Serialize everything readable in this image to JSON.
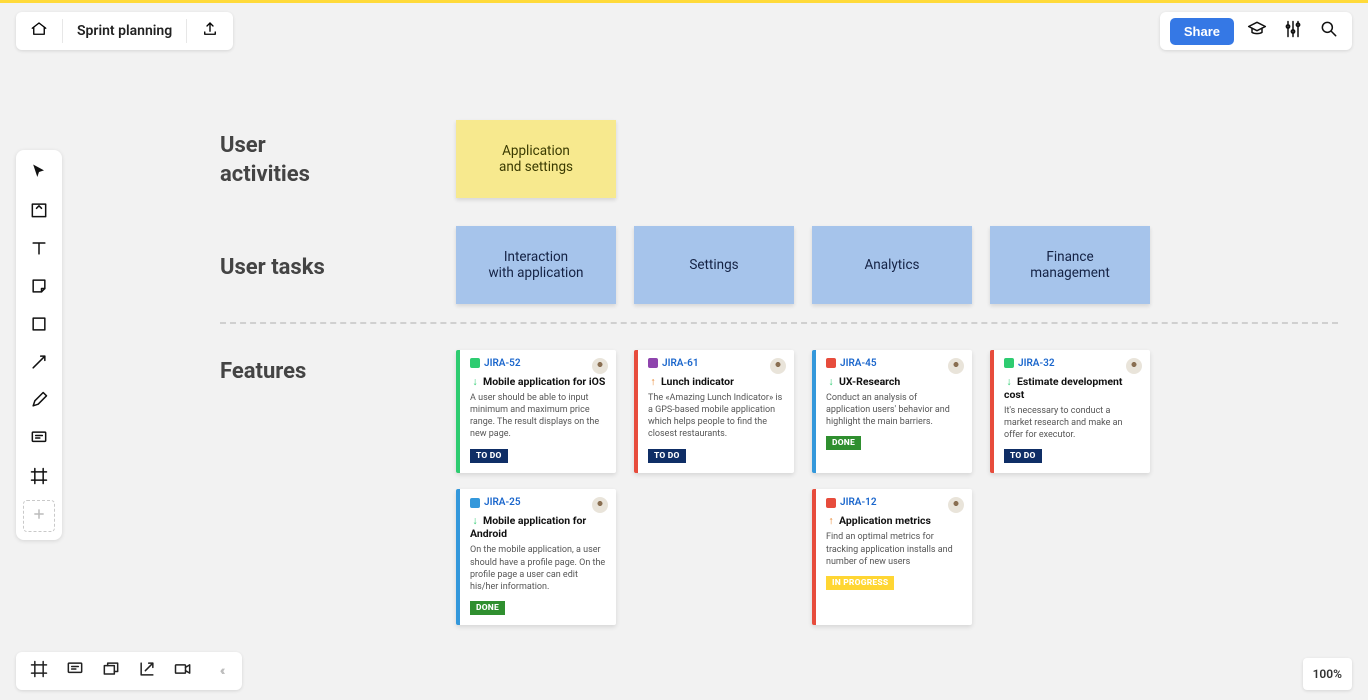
{
  "board_title": "Sprint planning",
  "share_label": "Share",
  "zoom_label": "100%",
  "rows": {
    "activities": "User\nactivities",
    "tasks": "User tasks",
    "features": "Features"
  },
  "activities": [
    {
      "label": "Application\nand settings"
    }
  ],
  "tasks": [
    {
      "label": "Interaction\nwith application"
    },
    {
      "label": "Settings"
    },
    {
      "label": "Analytics"
    },
    {
      "label": "Finance\nmanagement"
    }
  ],
  "status_map": {
    "TODO": "TO DO",
    "DONE": "DONE",
    "INPROGRESS": "IN PROGRESS"
  },
  "cards": [
    [
      {
        "key": "JIRA-52",
        "stripe": "#2ecc71",
        "type_color": "#2ecc71",
        "priority": "low",
        "title": "Mobile application for iOS",
        "desc": "A user should be able to input minimum and maximum price range. The result displays on the new page.",
        "status": "TODO"
      },
      {
        "key": "JIRA-61",
        "stripe": "#e74c3c",
        "type_color": "#8e44ad",
        "priority": "high",
        "title": "Lunch indicator",
        "desc": "The «Amazing Lunch Indicator» is a GPS-based mobile application which helps people to find the closest restaurants.",
        "status": "TODO"
      },
      {
        "key": "JIRA-45",
        "stripe": "#3498db",
        "type_color": "#e74c3c",
        "priority": "low",
        "title": "UX-Research",
        "desc": "Conduct an analysis of application users' behavior and highlight the main barriers.",
        "status": "DONE"
      },
      {
        "key": "JIRA-32",
        "stripe": "#e74c3c",
        "type_color": "#2ecc71",
        "priority": "low",
        "title": "Estimate development cost",
        "desc": "It's necessary to conduct a market research and make an offer for executor.",
        "status": "TODO"
      }
    ],
    [
      {
        "key": "JIRA-25",
        "stripe": "#3498db",
        "type_color": "#3498db",
        "priority": "low",
        "title": "Mobile application for Android",
        "desc": "On the mobile application, a user should have a profile page. On the profile page a user can edit his/her information.",
        "status": "DONE"
      },
      null,
      {
        "key": "JIRA-12",
        "stripe": "#e74c3c",
        "type_color": "#e74c3c",
        "priority": "high",
        "title": "Application metrics",
        "desc": "Find an optimal metrics for tracking application installs and number of new users",
        "status": "INPROGRESS"
      },
      null
    ]
  ]
}
